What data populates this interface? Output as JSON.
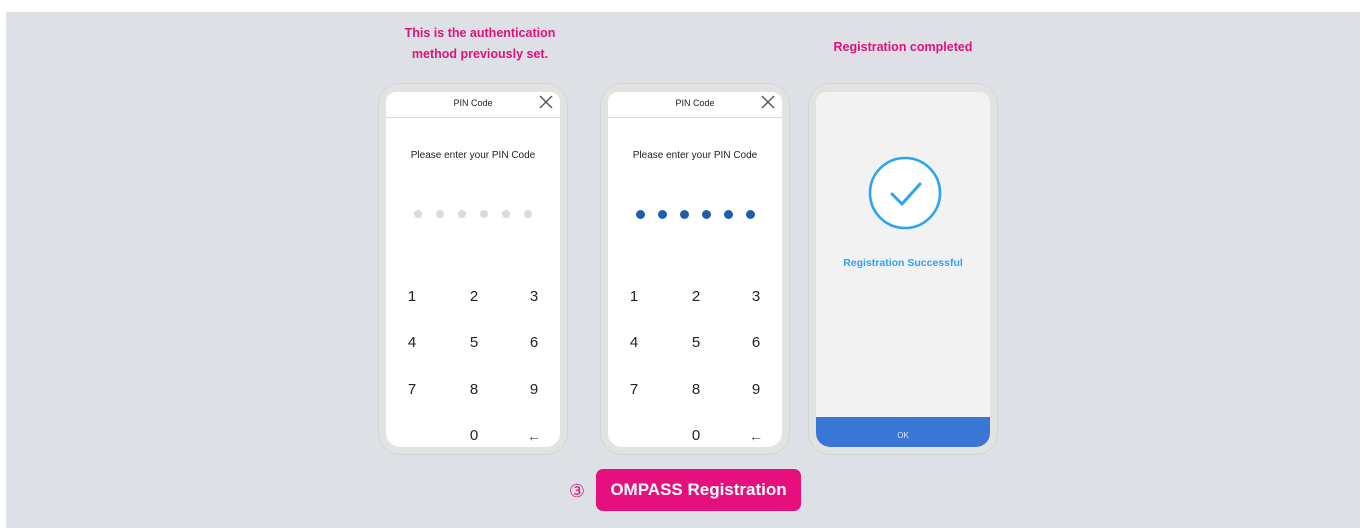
{
  "captions": {
    "previous_line1": "This is the authentication",
    "previous_line2": "method previously set.",
    "completed": "Registration completed"
  },
  "pin_screen": {
    "title": "PIN Code",
    "prompt": "Please enter your PIN Code",
    "close_icon": "close-icon",
    "keys": [
      "1",
      "2",
      "3",
      "4",
      "5",
      "6",
      "7",
      "8",
      "9",
      "0",
      "←"
    ]
  },
  "success_screen": {
    "icon": "check-circle-icon",
    "message": "Registration Successful",
    "ok_label": "OK"
  },
  "step": {
    "marker": "③",
    "button_label": "OMPASS Registration"
  },
  "colors": {
    "accent_pink": "#e5107e",
    "pin_dot_filled": "#1d5faa",
    "pin_dot_empty": "#dadada",
    "success_blue": "#2aa4f4",
    "ok_button": "#3a76d6",
    "background": "#dde1e6"
  }
}
